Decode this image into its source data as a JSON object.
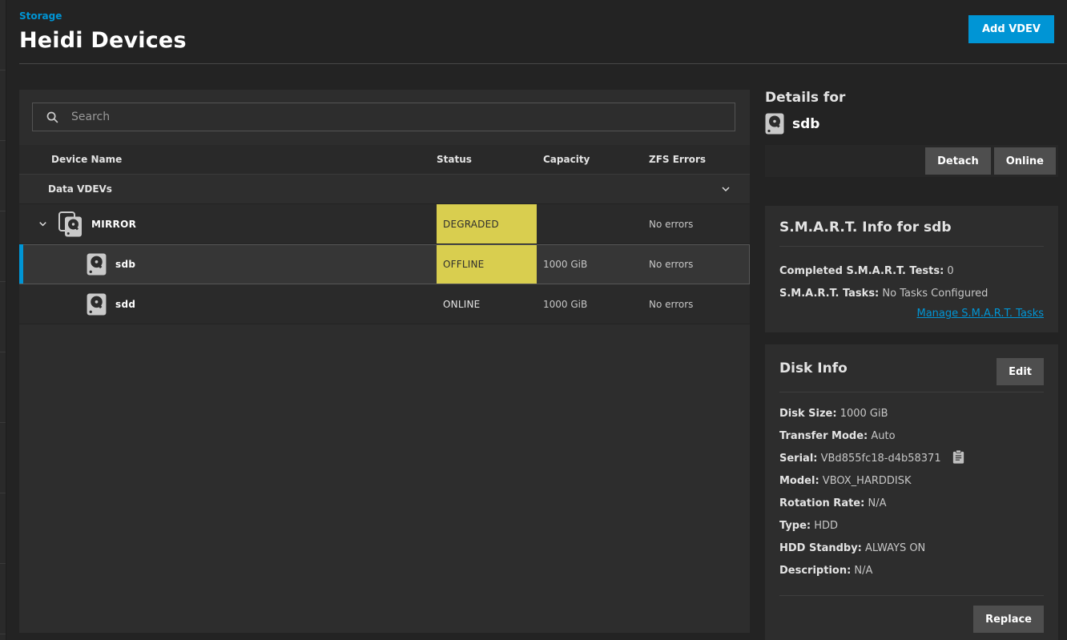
{
  "header": {
    "breadcrumb": "Storage",
    "title": "Heidi Devices",
    "add_vdev_label": "Add VDEV"
  },
  "table": {
    "search_placeholder": "Search",
    "columns": {
      "name": "Device Name",
      "status": "Status",
      "capacity": "Capacity",
      "zfs": "ZFS Errors"
    },
    "group_label": "Data VDEVs",
    "rows": [
      {
        "name": "MIRROR",
        "type": "mirror",
        "level": 1,
        "expandable": true,
        "selected": false,
        "status": "DEGRADED",
        "status_highlight": true,
        "capacity": "",
        "zfs_errors": "No errors"
      },
      {
        "name": "sdb",
        "type": "disk",
        "level": 2,
        "expandable": false,
        "selected": true,
        "status": "OFFLINE",
        "status_highlight": true,
        "capacity": "1000 GiB",
        "zfs_errors": "No errors"
      },
      {
        "name": "sdd",
        "type": "disk",
        "level": 2,
        "expandable": false,
        "selected": false,
        "status": "ONLINE",
        "status_highlight": false,
        "capacity": "1000 GiB",
        "zfs_errors": "No errors"
      }
    ]
  },
  "details": {
    "title": "Details for",
    "device": "sdb",
    "actions": {
      "detach": "Detach",
      "online": "Online"
    },
    "smart": {
      "title": "S.M.A.R.T. Info for sdb",
      "completed_tests_label": "Completed S.M.A.R.T. Tests:",
      "completed_tests_value": "0",
      "tasks_label": "S.M.A.R.T. Tasks:",
      "tasks_value": "No Tasks Configured",
      "manage_link": "Manage S.M.A.R.T. Tasks"
    },
    "disk_info": {
      "title": "Disk Info",
      "edit_label": "Edit",
      "fields": [
        {
          "label": "Disk Size:",
          "value": "1000 GiB"
        },
        {
          "label": "Transfer Mode:",
          "value": "Auto"
        },
        {
          "label": "Serial:",
          "value": "VBd855fc18-d4b58371",
          "copyable": true
        },
        {
          "label": "Model:",
          "value": "VBOX_HARDDISK"
        },
        {
          "label": "Rotation Rate:",
          "value": "N/A"
        },
        {
          "label": "Type:",
          "value": "HDD"
        },
        {
          "label": "HDD Standby:",
          "value": "ALWAYS ON"
        },
        {
          "label": "Description:",
          "value": "N/A"
        }
      ],
      "replace_label": "Replace"
    }
  },
  "colors": {
    "accent": "#0095d5",
    "warning": "#d9ce4f"
  }
}
